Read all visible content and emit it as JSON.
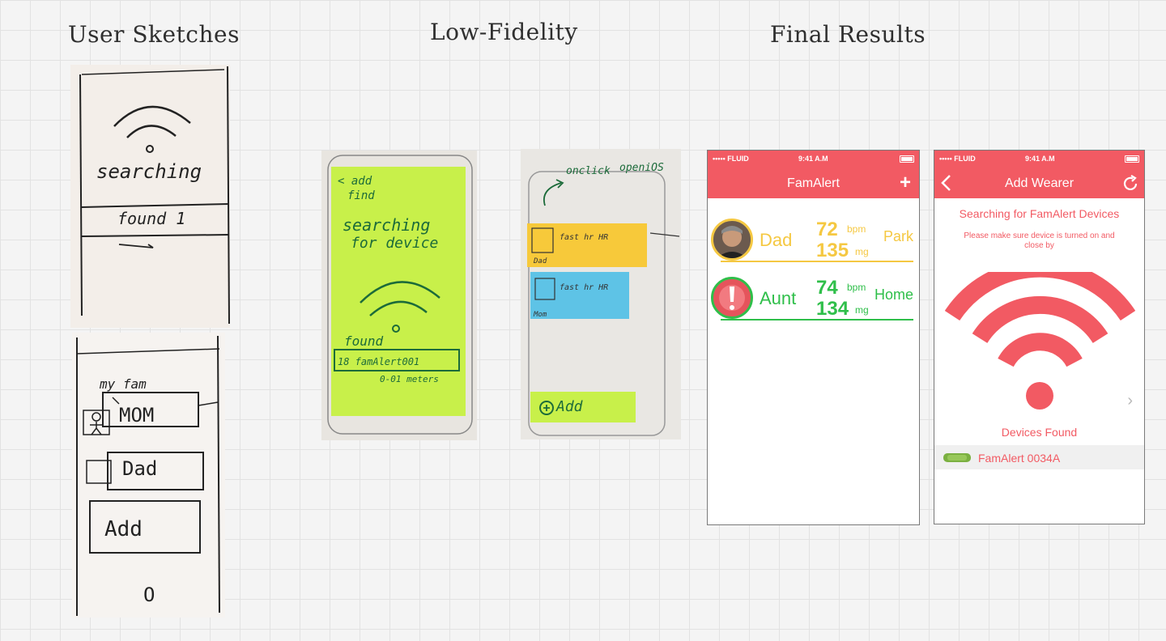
{
  "headings": {
    "sketches": "User Sketches",
    "lowfi": "Low-Fidelity",
    "final": "Final Results"
  },
  "sketch1": {
    "searching": "searching",
    "found": "found 1"
  },
  "sketch2": {
    "my_fam": "my fam",
    "mom": "MOM",
    "dad": "Dad",
    "add": "Add",
    "o": "O"
  },
  "lowfi1": {
    "add": "< add",
    "find": "find",
    "searching": "searching",
    "for_device": "for device",
    "found": "found",
    "device_id": "18 famAlert001",
    "distance": "0-01 meters"
  },
  "lowfi2": {
    "note_top": "onclick",
    "note_open": "openiOS",
    "card1": "fast hr HR",
    "card1_name": "Dad",
    "card2": "fast hr HR",
    "card2_name": "Mom",
    "add": "Add"
  },
  "phone1": {
    "status": {
      "carrier": "••••• FLUID",
      "time": "9:41 A.M"
    },
    "title": "FamAlert",
    "plus": "+",
    "members": [
      {
        "name": "Dad",
        "bpm": "72",
        "bpm_unit": "bpm",
        "mg": "135",
        "mg_unit": "mg",
        "place": "Park"
      },
      {
        "name": "Aunt",
        "bpm": "74",
        "bpm_unit": "bpm",
        "mg": "134",
        "mg_unit": "mg",
        "place": "Home"
      }
    ],
    "alert_mark": "!"
  },
  "phone2": {
    "status": {
      "carrier": "••••• FLUID",
      "time": "9:41 A.M"
    },
    "title": "Add Wearer",
    "searching": "Searching for FamAlert Devices",
    "hint": "Please make sure device is turned on and close by",
    "found_label": "Devices Found",
    "device": "FamAlert 0034A",
    "chevron": "›"
  },
  "colors": {
    "brand": "#f25a63",
    "yellow": "#f5c842",
    "green": "#2fbf4a",
    "sticky_green": "#c8f04a",
    "sticky_yellow": "#f7c93a",
    "sticky_blue": "#5ec3e6"
  }
}
